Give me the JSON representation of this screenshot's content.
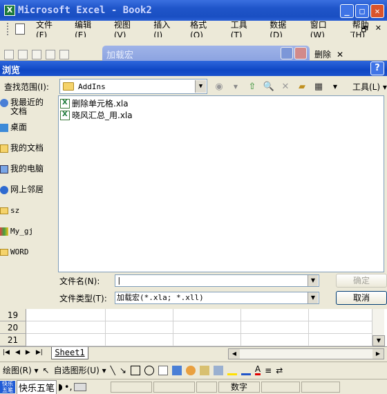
{
  "window": {
    "title": "Microsoft Excel - Book2",
    "icon_label": "X"
  },
  "menubar": {
    "items": [
      "文件(F)",
      "编辑(E)",
      "视图(V)",
      "插入(I)",
      "格式(O)",
      "工具(T)",
      "数据(D)",
      "窗口(W)",
      "帮助(H)"
    ],
    "doc_controls": [
      "_",
      "🗗",
      "✕"
    ]
  },
  "background_dialog": {
    "title": "加载宏",
    "toolbar_right_label": "删除"
  },
  "dialog": {
    "title": "浏览",
    "help_label": "?",
    "look_in_label": "查找范围(I):",
    "look_in_value": "AddIns",
    "tools_label": "工具(L)",
    "places": [
      {
        "label": "我最近的文档"
      },
      {
        "label": "桌面"
      },
      {
        "label": "我的文档"
      },
      {
        "label": "我的电脑"
      },
      {
        "label": "网上邻居"
      },
      {
        "label": "sz"
      },
      {
        "label": "My_gj"
      },
      {
        "label": "WORD"
      }
    ],
    "files": [
      "删除单元格.xla",
      "晓风汇总_用.xla"
    ],
    "filename_label": "文件名(N):",
    "filename_value": "",
    "filetype_label": "文件类型(T):",
    "filetype_value": "加载宏(*.xla; *.xll)",
    "ok_label": "确定",
    "cancel_label": "取消"
  },
  "sheet": {
    "rows": [
      "19",
      "20",
      "21"
    ],
    "tab_name": "Sheet1"
  },
  "drawing_toolbar": {
    "draw_label": "绘图(R)",
    "autoshapes_label": "自选图形(U)"
  },
  "statusbar": {
    "ime_name": "快乐五笔",
    "ime_logo": "快乐五笔",
    "num_label": "数字"
  },
  "colors": {
    "title_blue": "#1f55c9",
    "dialog_face": "#ece9d8",
    "folder_yellow": "#f5d36b"
  }
}
